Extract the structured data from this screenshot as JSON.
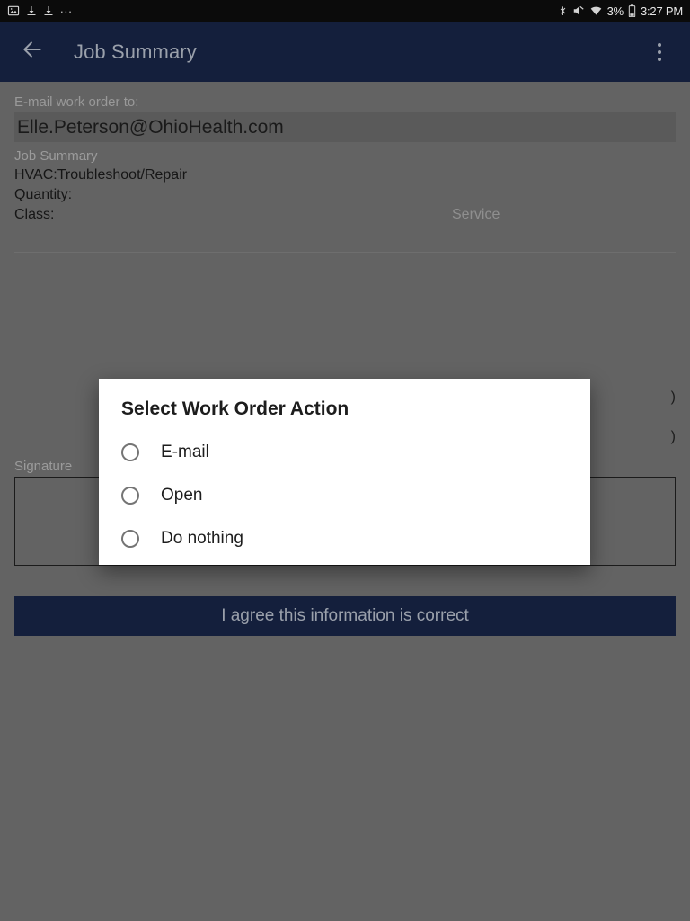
{
  "status_bar": {
    "left_icons": [
      "screenshot-image-icon",
      "download-icon",
      "download-icon"
    ],
    "ellipsis": "...",
    "right_icons": [
      "bluetooth-icon",
      "volume-muted-icon",
      "wifi-icon"
    ],
    "battery_percent": "3%",
    "battery_icon": "battery-icon",
    "time": "3:27 PM"
  },
  "app_bar": {
    "back_icon": "back-arrow-icon",
    "title": "Job Summary",
    "overflow_icon": "overflow-menu-icon"
  },
  "form": {
    "email_label": "E-mail work order to:",
    "email_value": "Elle.Peterson@OhioHealth.com",
    "summary_section_label": "Job Summary",
    "task": "HVAC:Troubleshoot/Repair",
    "quantity_label": "Quantity:",
    "quantity_value": "",
    "class_label": "Class:",
    "class_value": "Service",
    "occluded_value_1": ")",
    "occluded_value_2": ")",
    "signature_label": "Signature",
    "signature_value": ""
  },
  "agree_button": {
    "label": "I agree this information is correct"
  },
  "dialog": {
    "title": "Select Work Order Action",
    "options": [
      {
        "label": "E-mail",
        "selected": false
      },
      {
        "label": "Open",
        "selected": false
      },
      {
        "label": "Do nothing",
        "selected": false
      }
    ]
  },
  "colors": {
    "app_bar": "#141f3c",
    "page_background": "#636363",
    "email_field_background": "#5a5a5a",
    "dialog_background": "#ffffff",
    "status_bar": "#0b0b0b",
    "accent": "#1a73e8"
  }
}
